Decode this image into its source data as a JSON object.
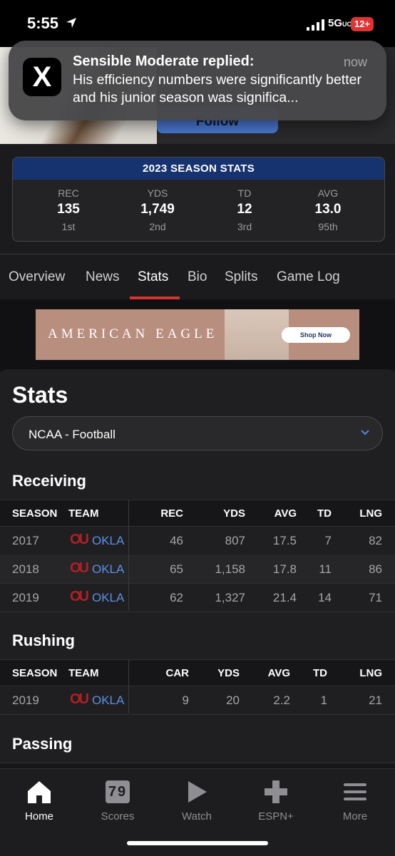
{
  "status_bar": {
    "time": "5:55",
    "network": "5G",
    "network_sub": "UC",
    "battery": "12+"
  },
  "header": {
    "follow_label": "Follow"
  },
  "notification": {
    "app": "X",
    "title": "Sensible Moderate replied:",
    "time": "now",
    "body": "His efficiency numbers were significantly better and his junior season was significa..."
  },
  "season_stats": {
    "title": "2023 SEASON STATS",
    "stats": [
      {
        "label": "REC",
        "value": "135",
        "rank": "1st"
      },
      {
        "label": "YDS",
        "value": "1,749",
        "rank": "2nd"
      },
      {
        "label": "TD",
        "value": "12",
        "rank": "3rd"
      },
      {
        "label": "AVG",
        "value": "13.0",
        "rank": "95th"
      }
    ]
  },
  "tabs": [
    "Overview",
    "News",
    "Stats",
    "Bio",
    "Splits",
    "Game Log"
  ],
  "active_tab": "Stats",
  "ad": {
    "brand": "AMERICAN EAGLE",
    "cta": "Shop Now"
  },
  "stats": {
    "title": "Stats",
    "league_select": "NCAA - Football",
    "receiving": {
      "title": "Receiving",
      "columns": [
        "SEASON",
        "TEAM",
        "REC",
        "YDS",
        "AVG",
        "TD",
        "LNG"
      ],
      "rows": [
        [
          "2017",
          "OKLA",
          "46",
          "807",
          "17.5",
          "7",
          "82"
        ],
        [
          "2018",
          "OKLA",
          "65",
          "1,158",
          "17.8",
          "11",
          "86"
        ],
        [
          "2019",
          "OKLA",
          "62",
          "1,327",
          "21.4",
          "14",
          "71"
        ]
      ]
    },
    "rushing": {
      "title": "Rushing",
      "columns": [
        "SEASON",
        "TEAM",
        "CAR",
        "YDS",
        "AVG",
        "TD",
        "LNG"
      ],
      "rows": [
        [
          "2019",
          "OKLA",
          "9",
          "20",
          "2.2",
          "1",
          "21"
        ]
      ]
    },
    "passing": {
      "title": "Passing"
    }
  },
  "tabbar": [
    {
      "label": "Home",
      "icon": "home-icon"
    },
    {
      "label": "Scores",
      "icon": "scoreboard-icon",
      "icon_text": "79"
    },
    {
      "label": "Watch",
      "icon": "play-icon"
    },
    {
      "label": "ESPN+",
      "icon": "plus-icon"
    },
    {
      "label": "More",
      "icon": "menu-icon"
    }
  ],
  "colors": {
    "accent_red": "#d1362f",
    "link_blue": "#5b8fe6",
    "ou_crimson": "#b01f24",
    "season_header": "#17336f"
  }
}
